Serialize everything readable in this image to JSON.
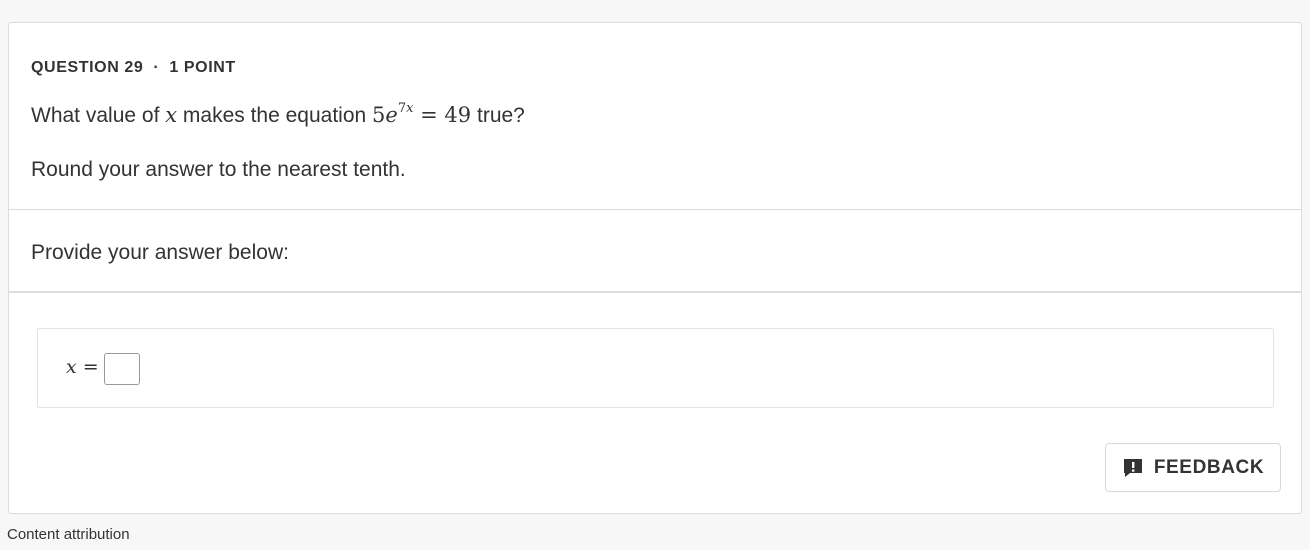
{
  "question": {
    "number_label": "QUESTION 29",
    "separator": "·",
    "points_label": "1 POINT",
    "prompt_prefix": "What value of ",
    "prompt_var": "x",
    "prompt_middle": " makes the equation ",
    "equation_coef": "5",
    "equation_base": "e",
    "equation_exponent": "7x",
    "equation_rhs": " = 49",
    "prompt_suffix": " true?",
    "instruction": "Round your answer to the nearest tenth."
  },
  "answer": {
    "heading": "Provide your answer below:",
    "label_var": "x",
    "label_eq": " =",
    "input_value": ""
  },
  "feedback": {
    "icon": "feedback-exclamation-icon",
    "label": "FEEDBACK"
  },
  "footer": {
    "attribution_link": "Content attribution"
  }
}
